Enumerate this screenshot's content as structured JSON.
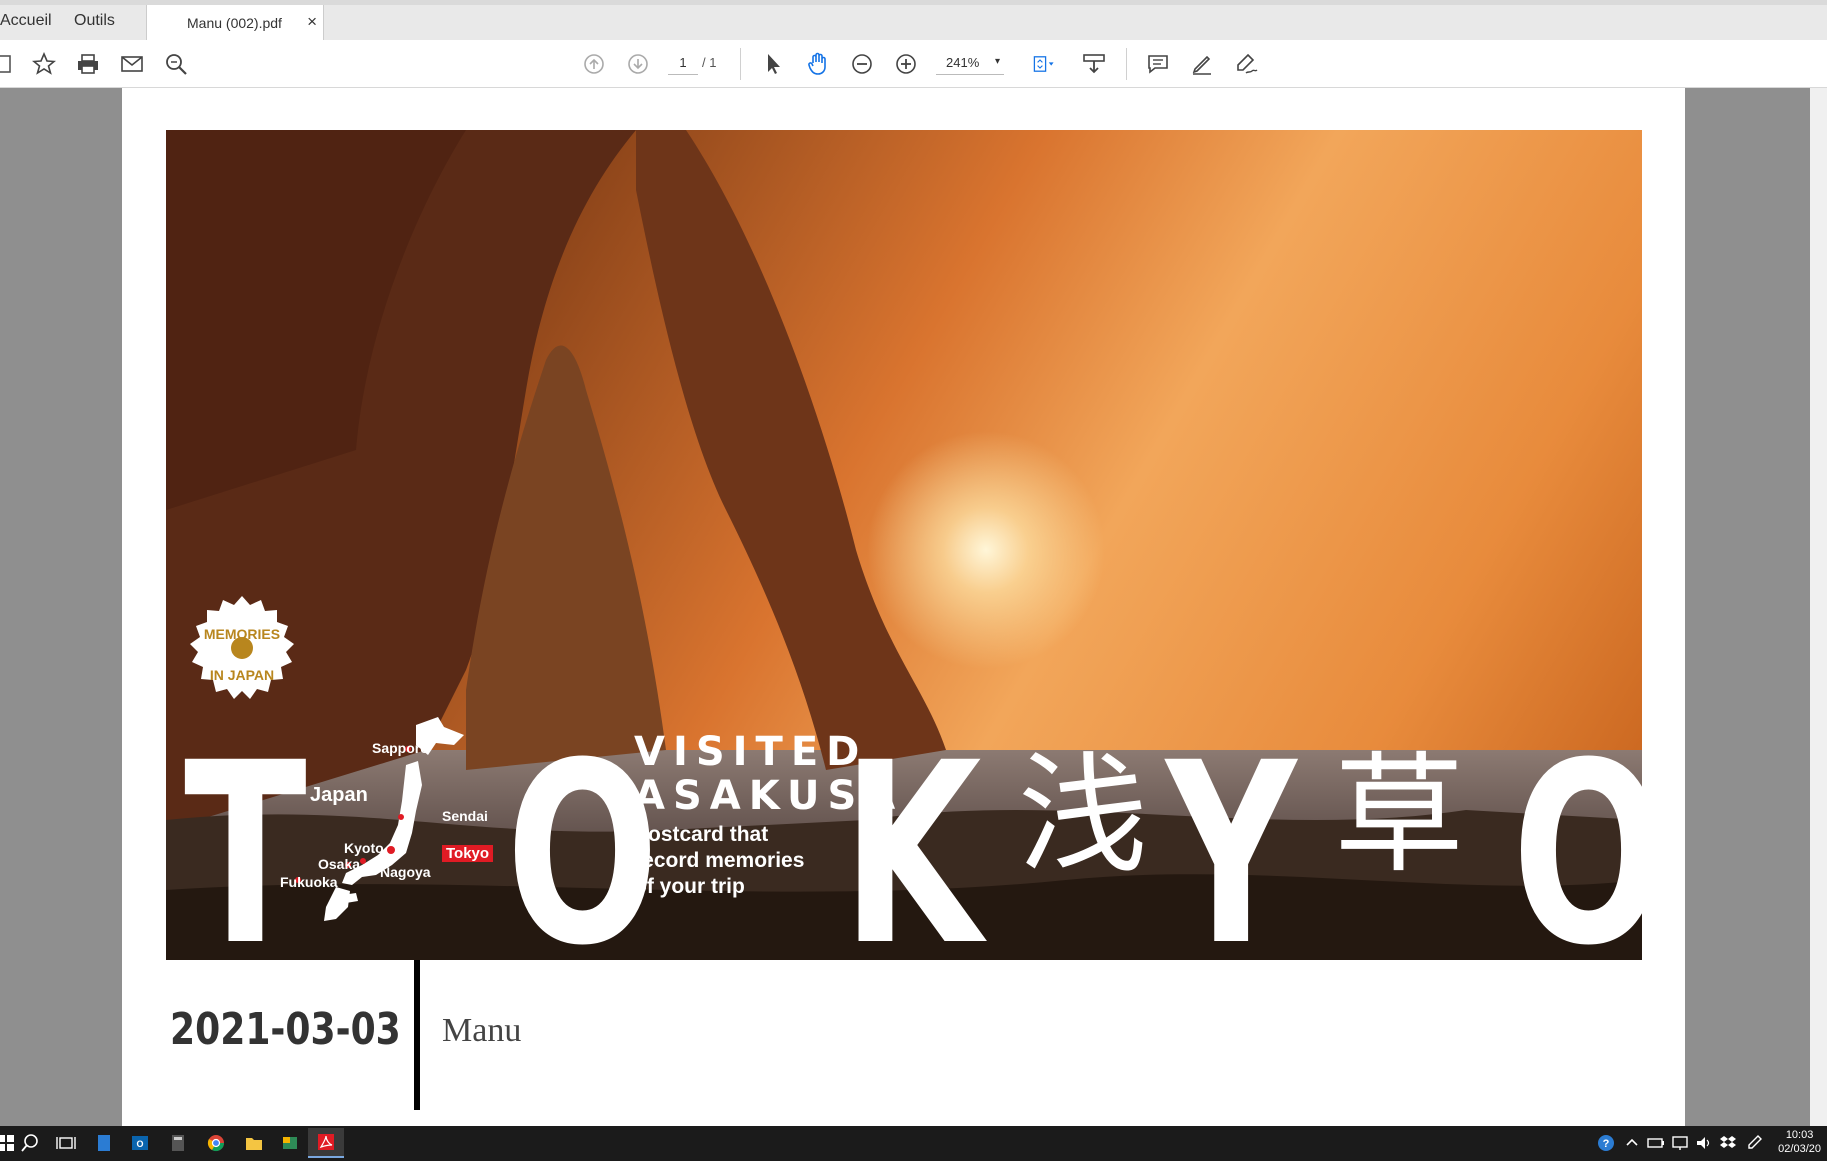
{
  "tabs": {
    "home": "Accueil",
    "tools": "Outils",
    "doc": "Manu (002).pdf",
    "close": "×"
  },
  "toolbar": {
    "page_current": "1",
    "page_total": "/ 1",
    "zoom": "241%",
    "zoom_caret": "▾"
  },
  "postcard": {
    "badge_top": "MEMORIES",
    "badge_bottom": "IN JAPAN",
    "big_letters": [
      "T",
      "O",
      "K",
      "Y",
      "O"
    ],
    "kanji": [
      "浅",
      "草"
    ],
    "visited_line1": "VISITED",
    "visited_line2": "ASAKUSA",
    "tagline": "Postcard that record memories of your trip",
    "map_title": "Japan",
    "cities": {
      "sapporo": "Sapporo",
      "sendai": "Sendai",
      "kyoto": "Kyoto",
      "osaka": "Osaka",
      "nagoya": "Nagoya",
      "fukuoka": "Fukuoka",
      "tokyo": "Tokyo"
    },
    "date": "2021-03-03",
    "name": "Manu"
  },
  "taskbar": {
    "time": "10:03",
    "date": "02/03/20"
  },
  "colors": {
    "accent_red": "#e01b24",
    "badge_gold": "#b8861e",
    "toolbar_blue": "#1473e6"
  }
}
